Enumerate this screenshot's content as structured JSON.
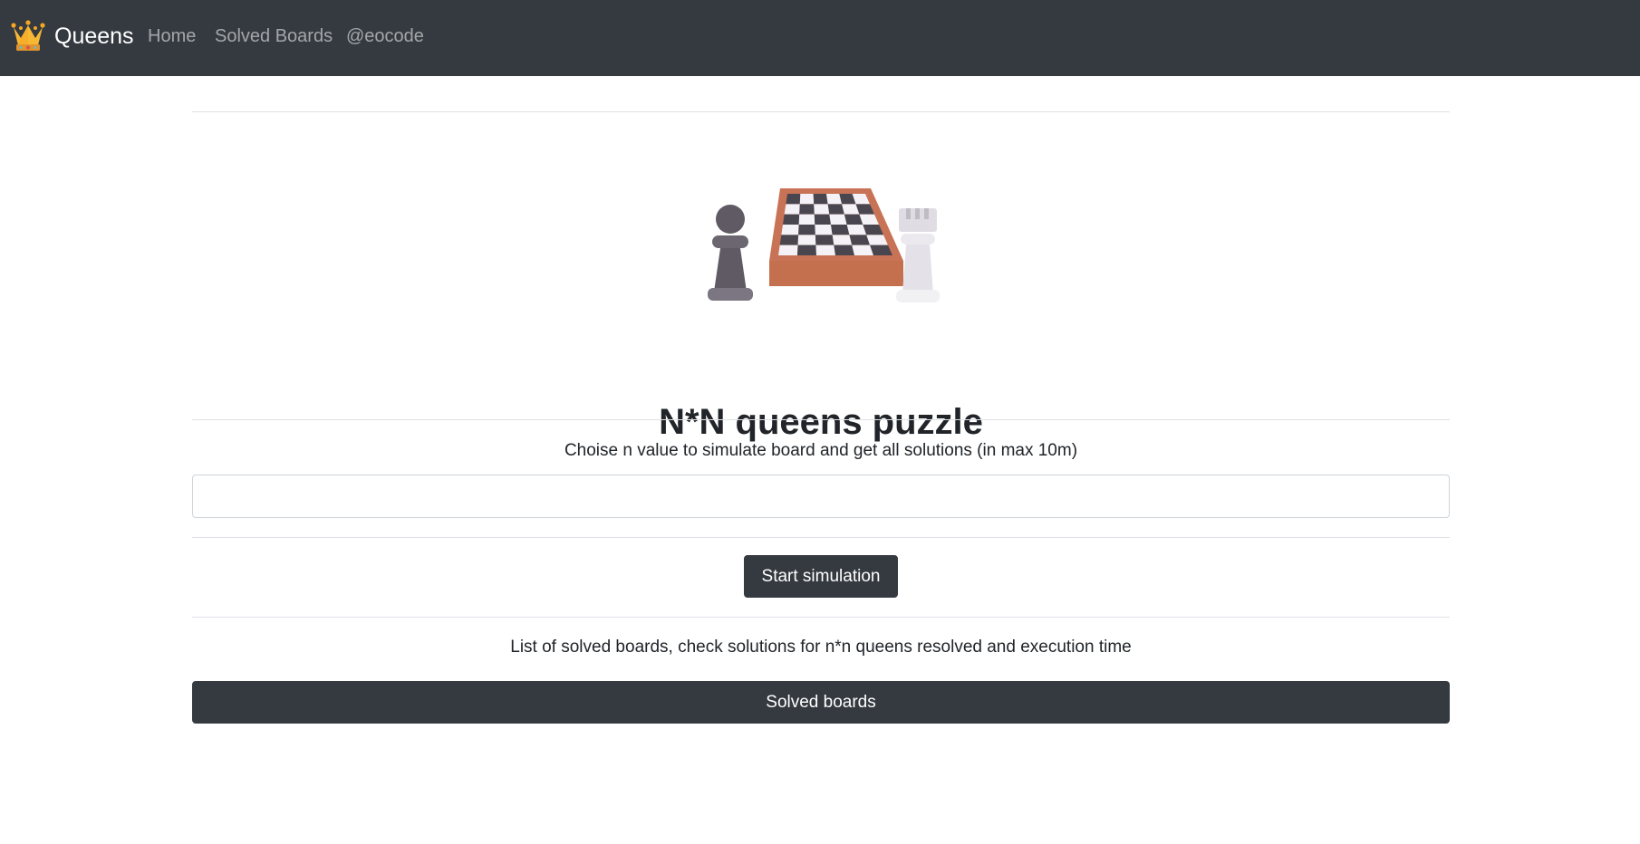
{
  "navbar": {
    "brand_icon": "crown-icon",
    "brand_text": "Queens",
    "links": [
      {
        "label": "Home"
      },
      {
        "label": "Solved Boards"
      },
      {
        "label": "@eocode"
      }
    ],
    "background": "#343a40"
  },
  "main": {
    "illustration": "chessboard-with-pawn-and-rook",
    "title": "N*N queens puzzle",
    "instruction": "Choise n value to simulate board and get all solutions (in max 10m)",
    "n_input": {
      "value": "",
      "placeholder": ""
    },
    "start_button_label": "Start simulation",
    "solved_description": "List of solved boards, check solutions for n*n queens resolved and execution time",
    "solved_button_label": "Solved boards"
  },
  "colors": {
    "dark": "#343a40",
    "board_wood": "#c87356",
    "dark_square": "#4a4650",
    "light_square": "#f4f2f6"
  }
}
